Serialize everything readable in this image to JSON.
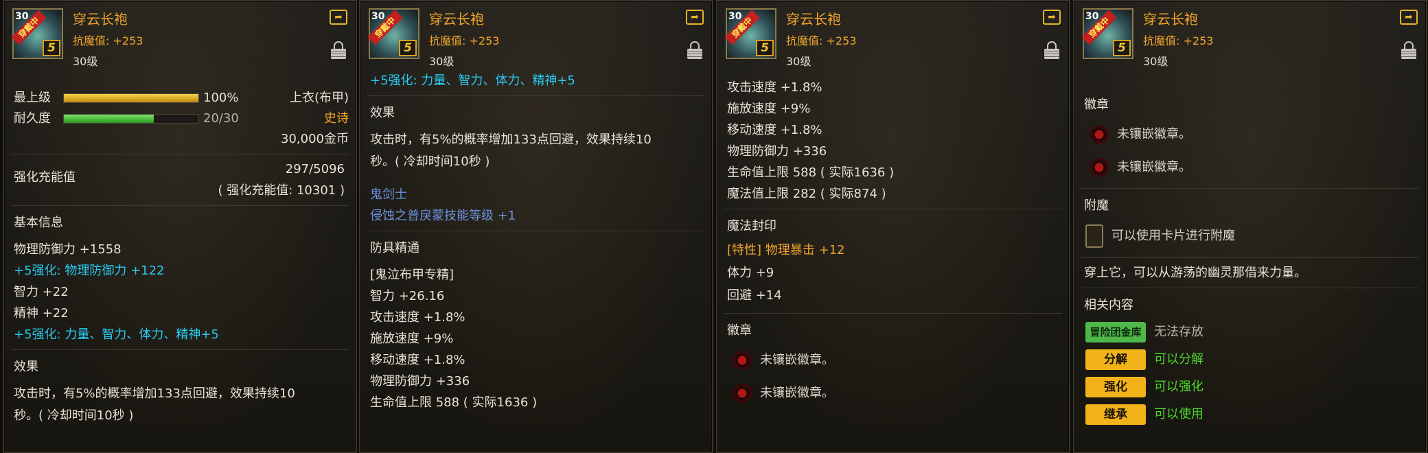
{
  "item": {
    "name": "穿云长袍",
    "resist": "抗魔值: +253",
    "level": "30级",
    "thumb_level": "30",
    "thumb_badge": "穿戴中",
    "thumb_plus": "5"
  },
  "p1": {
    "grade_label": "最上级",
    "grade_pct": "100%",
    "grade_fill": 100,
    "slot_type": "上衣(布甲)",
    "dur_label": "耐久度",
    "dur_val": "20/30",
    "dur_fill": 66.7,
    "rarity": "史诗",
    "price": "30,000金币",
    "charge_label": "强化充能值",
    "charge_val": "297/5096",
    "charge_note": "( 强化充能值: 10301 )",
    "basic_title": "基本信息",
    "basic": [
      {
        "t": "物理防御力 +1558",
        "c": "white"
      },
      {
        "t": "+5强化: 物理防御力 +122",
        "c": "cyan"
      },
      {
        "t": "智力 +22",
        "c": "white"
      },
      {
        "t": "精神 +22",
        "c": "white"
      },
      {
        "t": "+5强化: 力量、智力、体力、精神+5",
        "c": "cyan"
      }
    ],
    "effect_title": "效果",
    "effect_text": "攻击时，有5%的概率增加133点回避，效果持续10秒。( 冷却时间10秒 )"
  },
  "p2": {
    "top_line": "+5强化: 力量、智力、体力、精神+5",
    "effect_title": "效果",
    "effect_text": "攻击时，有5%的概率增加133点回避，效果持续10秒。( 冷却时间10秒 )",
    "class_name": "鬼剑士",
    "skill_line": "侵蚀之普戾蒙技能等级 +1",
    "mastery_title": "防具精通",
    "mastery": [
      "[鬼泣布甲专精]",
      "智力 +26.16",
      "攻击速度 +1.8%",
      "施放速度 +9%",
      "移动速度 +1.8%",
      "物理防御力 +336",
      "生命值上限 588 ( 实际1636 )"
    ]
  },
  "p3": {
    "stats": [
      "攻击速度 +1.8%",
      "施放速度 +9%",
      "移动速度 +1.8%",
      "物理防御力 +336",
      "生命值上限 588 ( 实际1636 )",
      "魔法值上限 282 ( 实际874 )"
    ],
    "seal_title": "魔法封印",
    "seals": [
      {
        "t": "[特性] 物理暴击 +12",
        "c": "orange"
      },
      {
        "t": "体力 +9",
        "c": "white"
      },
      {
        "t": "回避 +14",
        "c": "white"
      }
    ],
    "emblem_title": "徽章",
    "emblems": [
      "未镶嵌徽章。",
      "未镶嵌徽章。"
    ]
  },
  "p4": {
    "emblem_title": "徽章",
    "emblems": [
      "未镶嵌徽章。",
      "未镶嵌徽章。"
    ],
    "enchant_title": "附魔",
    "enchant_text": "可以使用卡片进行附魔",
    "flavor": "穿上它，可以从游荡的幽灵那借来力量。",
    "related_title": "相关内容",
    "related": [
      {
        "tag": "冒险团金库",
        "text": "无法存放",
        "tagc": "grn",
        "textc": "gray"
      },
      {
        "tag": "分解",
        "text": "可以分解",
        "tagc": "yel",
        "textc": "green"
      },
      {
        "tag": "强化",
        "text": "可以强化",
        "tagc": "yel",
        "textc": "green"
      },
      {
        "tag": "继承",
        "text": "可以使用",
        "tagc": "yel",
        "textc": "green"
      }
    ]
  },
  "icons": [
    "share-icon",
    "lock-icon",
    "emblem-slot-icon",
    "card-slot-icon"
  ],
  "colors": {
    "title": "#f0a52a",
    "enhance": "#29c9f0",
    "class": "#6c92e0",
    "positive": "#4cd62a",
    "tag": "#f2b21a"
  }
}
